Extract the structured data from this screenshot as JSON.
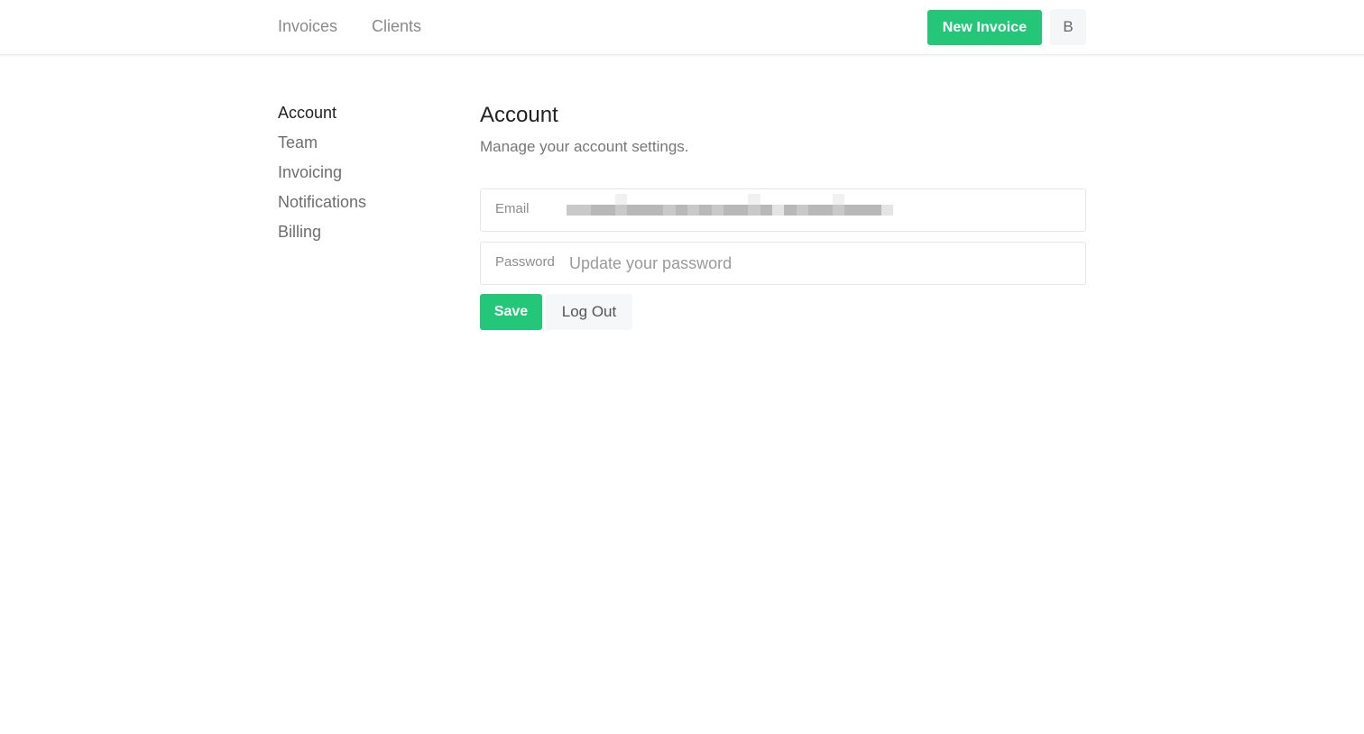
{
  "topnav": {
    "links": [
      {
        "label": "Invoices"
      },
      {
        "label": "Clients"
      }
    ],
    "new_invoice_label": "New Invoice",
    "avatar_initial": "B"
  },
  "sidebar": {
    "items": [
      {
        "label": "Account",
        "active": true
      },
      {
        "label": "Team",
        "active": false
      },
      {
        "label": "Invoicing",
        "active": false
      },
      {
        "label": "Notifications",
        "active": false
      },
      {
        "label": "Billing",
        "active": false
      }
    ]
  },
  "main": {
    "title": "Account",
    "subtitle": "Manage your account settings.",
    "email": {
      "label": "Email",
      "value": ""
    },
    "password": {
      "label": "Password",
      "placeholder": "Update your password",
      "value": ""
    },
    "save_label": "Save",
    "logout_label": "Log Out"
  },
  "colors": {
    "accent": "#23c777",
    "nav_text": "#8a8a8a",
    "muted_button_bg": "#f6f7f8"
  }
}
